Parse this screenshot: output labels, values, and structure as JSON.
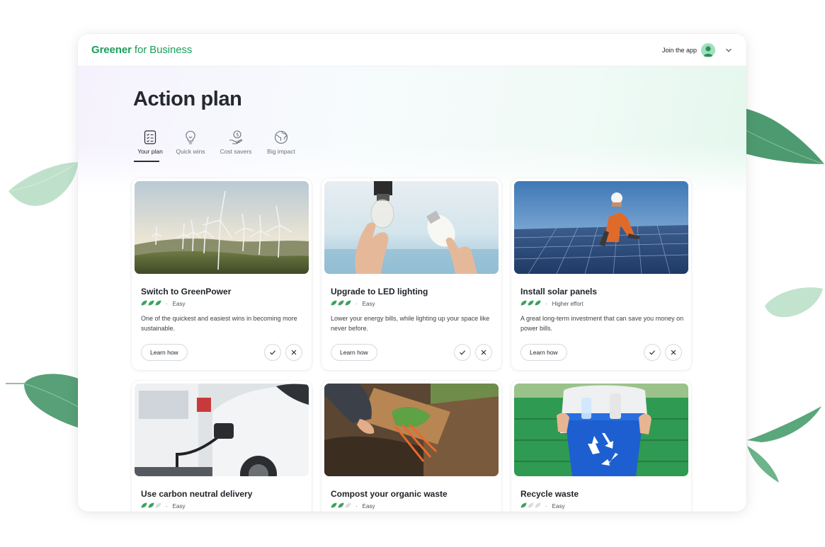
{
  "brand": {
    "name_bold": "Greener",
    "name_rest": " for Business",
    "color": "#1a9e5b"
  },
  "account": {
    "label": "Join the app",
    "avatar_icon": "user-avatar-icon",
    "menu_icon": "chevron-down-icon"
  },
  "page": {
    "title": "Action plan"
  },
  "tabs": [
    {
      "label": "Your plan",
      "icon": "checklist-icon",
      "active": true
    },
    {
      "label": "Quick wins",
      "icon": "lightbulb-icon",
      "active": false
    },
    {
      "label": "Cost savers",
      "icon": "money-hand-icon",
      "active": false
    },
    {
      "label": "Big impact",
      "icon": "globe-icon",
      "active": false
    }
  ],
  "cards": [
    {
      "title": "Switch to GreenPower",
      "effort": "Easy",
      "leaves_filled": 3,
      "description": "One of the quickest and easiest wins in becoming more sustainable.",
      "learn_label": "Learn how",
      "image": "wind-turbines"
    },
    {
      "title": "Upgrade to LED lighting",
      "effort": "Easy",
      "leaves_filled": 3,
      "description": "Lower your energy bills, while lighting up your space like never before.",
      "learn_label": "Learn how",
      "image": "light-bulbs"
    },
    {
      "title": "Install solar panels",
      "effort": "Higher effort",
      "leaves_filled": 3,
      "description": "A great long-term investment that can save you money on power bills.",
      "learn_label": "Learn how",
      "image": "solar-panels"
    },
    {
      "title": "Use carbon neutral delivery",
      "effort": "Easy",
      "leaves_filled": 2,
      "description": "",
      "learn_label": "",
      "image": "ev-charging"
    },
    {
      "title": "Compost your organic waste",
      "effort": "Easy",
      "leaves_filled": 2,
      "description": "",
      "learn_label": "",
      "image": "compost"
    },
    {
      "title": "Recycle waste",
      "effort": "Easy",
      "leaves_filled": 1,
      "description": "",
      "learn_label": "",
      "image": "recycling-bin"
    }
  ],
  "colors": {
    "accent": "#1a9e5b",
    "leaf_filled": "#3aa35f",
    "leaf_empty": "#d9dde0",
    "text": "#1f2328"
  }
}
